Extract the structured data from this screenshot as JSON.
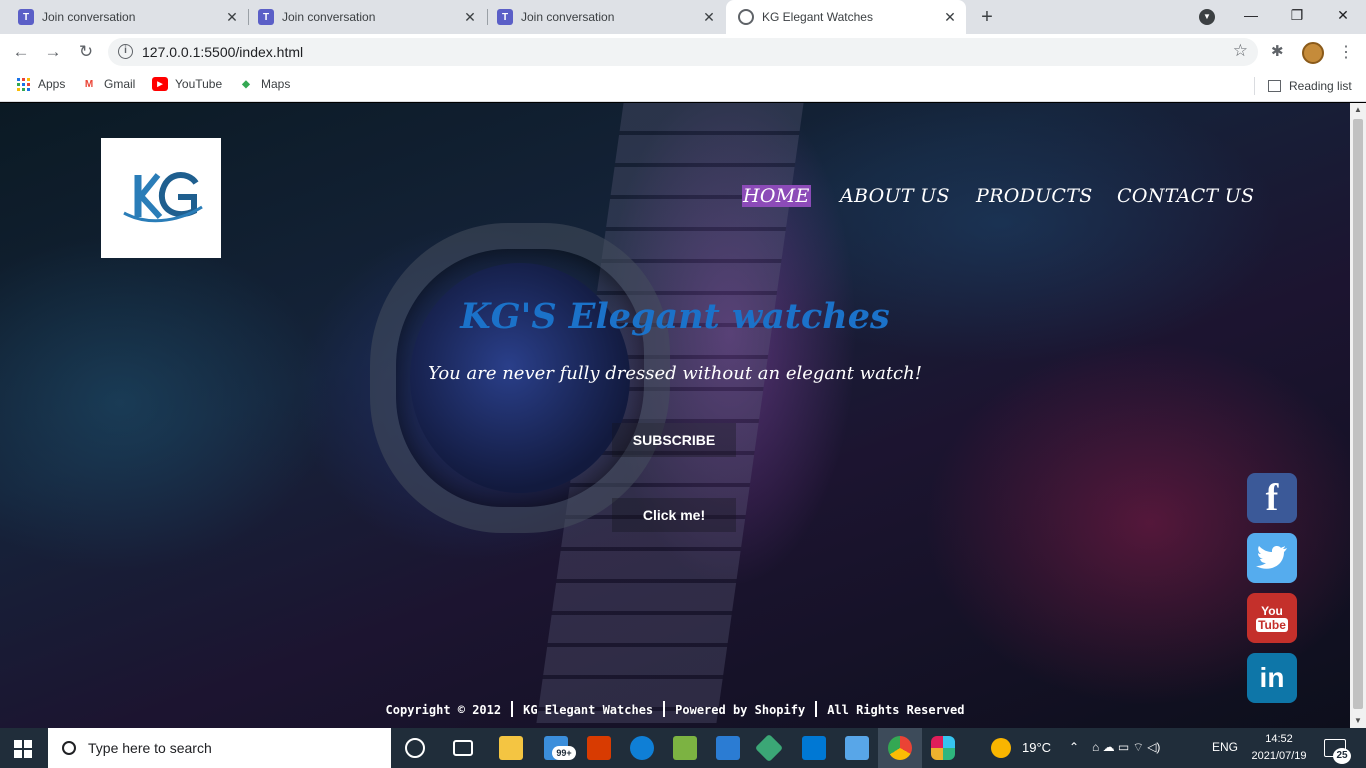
{
  "browser": {
    "tabs": [
      {
        "title": "Join conversation",
        "icon": "teams-icon"
      },
      {
        "title": "Join conversation",
        "icon": "teams-icon"
      },
      {
        "title": "Join conversation",
        "icon": "teams-icon"
      },
      {
        "title": "KG Elegant Watches",
        "icon": "globe-icon",
        "active": true
      }
    ],
    "url": "127.0.0.1:5500/index.html",
    "bookmarks": [
      "Apps",
      "Gmail",
      "YouTube",
      "Maps"
    ],
    "reading_list": "Reading list"
  },
  "site": {
    "logo_text": "KG",
    "nav": [
      "HOME",
      "ABOUT US",
      "PRODUCTS",
      "CONTACT US"
    ],
    "active_nav": "HOME",
    "hero_title": "KG'S Elegant watches",
    "hero_subtitle": "You are never fully dressed without an elegant watch!",
    "subscribe_label": "SUBSCRIBE",
    "click_label": "Click me!",
    "social": [
      {
        "name": "facebook-icon",
        "glyph": "f",
        "color": "#3b5998"
      },
      {
        "name": "twitter-icon",
        "color": "#55acee"
      },
      {
        "name": "youtube-icon",
        "glyph_top": "You",
        "glyph_bottom": "Tube",
        "color": "#c4302b"
      },
      {
        "name": "linkedin-icon",
        "glyph": "in",
        "color": "#0e76a8"
      }
    ],
    "footer": {
      "copyright": "Copyright © 2012",
      "company": "KG Elegant Watches",
      "powered": "Powered by Shopify",
      "rights": "All Rights Reserved"
    },
    "accent_color": "#1b72c9",
    "nav_highlight_color": "#8c4bb8"
  },
  "taskbar": {
    "search_placeholder": "Type here to search",
    "badge": "99+",
    "weather": "19°C",
    "language": "ENG",
    "time": "14:52",
    "date": "2021/07/19",
    "notifications": "25"
  }
}
